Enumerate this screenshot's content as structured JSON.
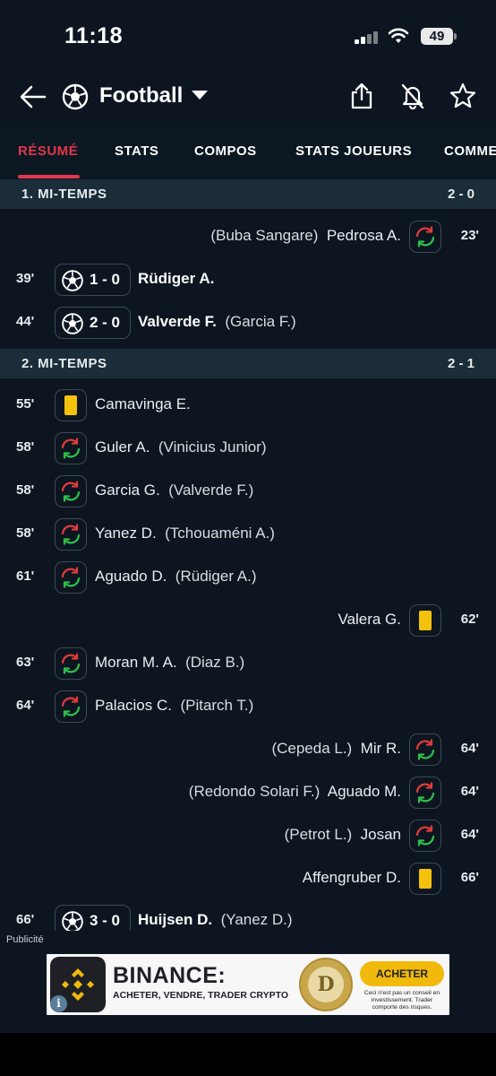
{
  "status_bar": {
    "time": "11:18",
    "battery": "49"
  },
  "header": {
    "title": "Football"
  },
  "tabs": [
    {
      "label": "RÉSUMÉ",
      "active": true
    },
    {
      "label": "STATS"
    },
    {
      "label": "COMPOS"
    },
    {
      "label": "STATS JOUEURS"
    },
    {
      "label": "COMMENTAIRES"
    }
  ],
  "sections": [
    {
      "title": "1. MI-TEMPS",
      "score": "2 - 0",
      "events": [
        {
          "side": "right",
          "type": "substitution",
          "minute": "23'",
          "player": "Pedrosa A.",
          "assist": "(Buba Sangare)"
        },
        {
          "side": "left",
          "type": "goal",
          "minute": "39'",
          "goal_score": "1 - 0",
          "player": "Rüdiger A.",
          "assist": ""
        },
        {
          "side": "left",
          "type": "goal",
          "minute": "44'",
          "goal_score": "2 - 0",
          "player": "Valverde F.",
          "assist": "(Garcia F.)"
        }
      ]
    },
    {
      "title": "2. MI-TEMPS",
      "score": "2 - 1",
      "events": [
        {
          "side": "left",
          "type": "yellow-card",
          "minute": "55'",
          "player": "Camavinga E.",
          "assist": ""
        },
        {
          "side": "left",
          "type": "substitution",
          "minute": "58'",
          "player": "Guler A.",
          "assist": "(Vinicius Junior)"
        },
        {
          "side": "left",
          "type": "substitution",
          "minute": "58'",
          "player": "Garcia G.",
          "assist": "(Valverde F.)"
        },
        {
          "side": "left",
          "type": "substitution",
          "minute": "58'",
          "player": "Yanez D.",
          "assist": "(Tchouaméni A.)"
        },
        {
          "side": "left",
          "type": "substitution",
          "minute": "61'",
          "player": "Aguado D.",
          "assist": "(Rüdiger A.)"
        },
        {
          "side": "right",
          "type": "yellow-card",
          "minute": "62'",
          "player": "Valera G.",
          "assist": ""
        },
        {
          "side": "left",
          "type": "substitution",
          "minute": "63'",
          "player": "Moran M. A.",
          "assist": "(Diaz B.)"
        },
        {
          "side": "left",
          "type": "substitution",
          "minute": "64'",
          "player": "Palacios C.",
          "assist": "(Pitarch T.)"
        },
        {
          "side": "right",
          "type": "substitution",
          "minute": "64'",
          "player": "Mir R.",
          "assist": "(Cepeda L.)"
        },
        {
          "side": "right",
          "type": "substitution",
          "minute": "64'",
          "player": "Aguado M.",
          "assist": "(Redondo Solari F.)"
        },
        {
          "side": "right",
          "type": "substitution",
          "minute": "64'",
          "player": "Josan",
          "assist": "(Petrot L.)"
        },
        {
          "side": "right",
          "type": "yellow-card",
          "minute": "66'",
          "player": "Affengruber D.",
          "assist": ""
        },
        {
          "side": "left",
          "type": "goal",
          "minute": "66'",
          "goal_score": "3 - 0",
          "player": "Huijsen D.",
          "assist": "(Yanez D.)"
        }
      ]
    }
  ],
  "ad": {
    "label": "Publicité",
    "brand": "BINANCE:",
    "tagline": "ACHETER, VENDRE, TRADER CRYPTO",
    "cta": "ACHETER",
    "disclaimer": "Ceci n'est pas un conseil en investissement. Trader comporte des risques.",
    "coin_letter": "D",
    "info": "i"
  },
  "colors": {
    "accent": "#e3364d",
    "yellow_card": "#f4c20d",
    "sub_in": "#2fbf4a",
    "sub_out": "#e23b3b",
    "background": "#0d1620"
  }
}
